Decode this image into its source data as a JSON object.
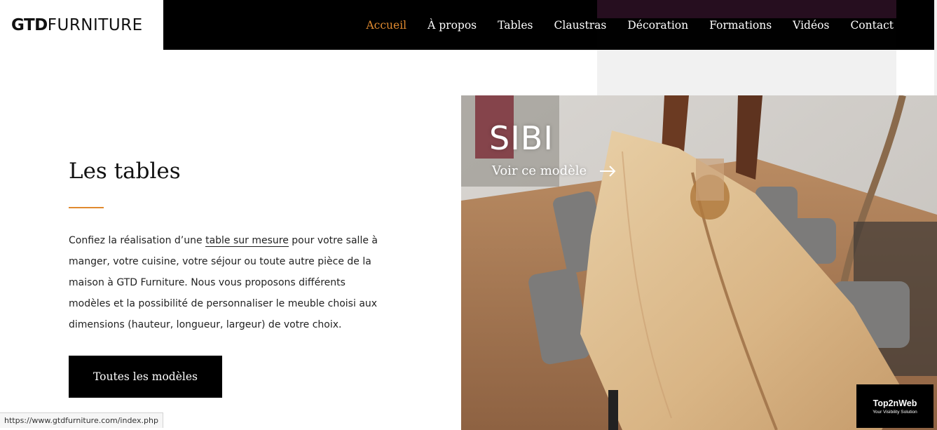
{
  "header": {
    "logo_bold": "GTD",
    "logo_thin": "FURNITURE",
    "nav": [
      {
        "label": "Accueil",
        "active": true
      },
      {
        "label": "À propos"
      },
      {
        "label": "Tables"
      },
      {
        "label": "Claustras"
      },
      {
        "label": "Décoration"
      },
      {
        "label": "Formations"
      },
      {
        "label": "Vidéos"
      },
      {
        "label": "Contact"
      }
    ]
  },
  "main": {
    "title": "Les tables",
    "paragraph_before": "Confiez la réalisation d’une ",
    "paragraph_link": "table sur mesure",
    "paragraph_after": " pour votre salle à manger, votre cuisine, votre séjour ou toute autre pièce de la maison à GTD Furniture. Nous vous proposons différents modèles et la possibilité de personnaliser le meuble choisi aux dimensions (hauteur, longueur, largeur) de votre choix.",
    "button_label": "Toutes les modèles"
  },
  "slide": {
    "title": "SIBI",
    "link_label": "Voir ce modèle"
  },
  "badge": {
    "name": "Top2nWeb",
    "tagline": "Your Visibility Solution"
  },
  "status_bar": {
    "url": "https://www.gtdfurniture.com/index.php"
  },
  "colors": {
    "accent": "#e08a2f",
    "nav_background": "#000000"
  },
  "icons": {
    "slide_arrow": "arrow-right-icon"
  }
}
